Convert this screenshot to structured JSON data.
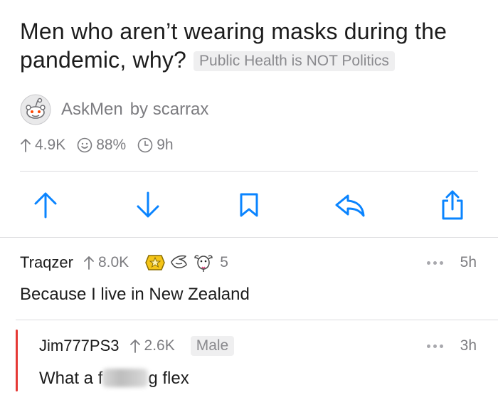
{
  "post": {
    "title": "Men who aren’t wearing masks during the pandemic, why?",
    "flair": "Public Health is NOT Politics",
    "subreddit": "AskMen",
    "by_label": "by scarrax",
    "upvotes": "4.9K",
    "upvote_ratio": "88%",
    "age": "9h"
  },
  "comments": [
    {
      "author": "Traqzer",
      "score": "8.0K",
      "awards": [
        "gold-award-icon",
        "hand-award-icon",
        "goat-award-icon"
      ],
      "award_count": "5",
      "age": "5h",
      "body": "Because I live in New Zealand"
    },
    {
      "author": "Jim777PS3",
      "score": "2.6K",
      "user_flair": "Male",
      "age": "3h",
      "body_before": "What a f",
      "body_after": "g flex"
    }
  ],
  "colors": {
    "action_blue": "#0a84ff",
    "thread_line": "#e53935",
    "meta_gray": "#7c7c80"
  }
}
